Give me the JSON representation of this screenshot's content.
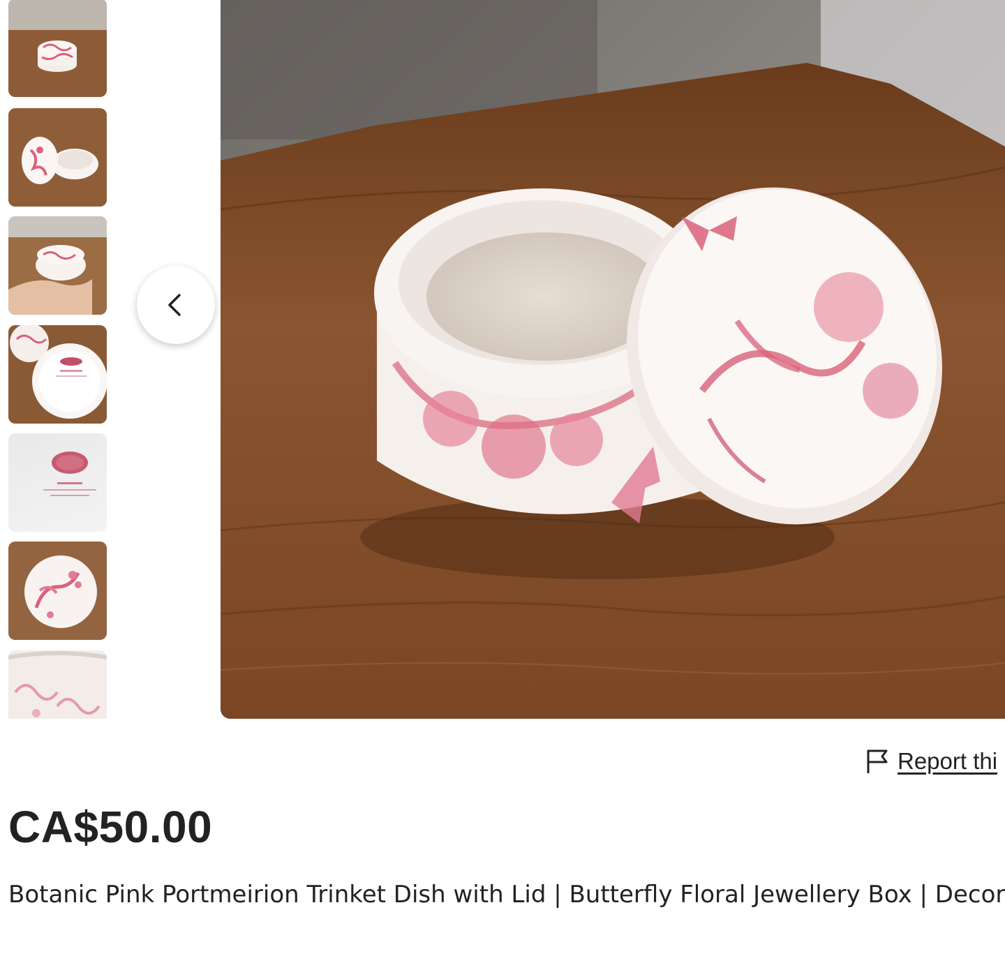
{
  "gallery": {
    "thumbnails": [
      {
        "icon": "lidded-dish-closed"
      },
      {
        "icon": "lidded-dish-open"
      },
      {
        "icon": "dish-in-hand"
      },
      {
        "icon": "dish-underside"
      },
      {
        "icon": "backstamp"
      },
      {
        "icon": "lid-top"
      },
      {
        "icon": "dish-side"
      }
    ],
    "prev_icon": "chevron-left-icon",
    "main_image_alt": "lidded-dish-open"
  },
  "listing": {
    "report_label": "Report thi",
    "report_icon": "flag-icon",
    "price": "CA$50.00",
    "title": "Botanic Pink Portmeirion Trinket Dish with Lid | Butterfly Floral Jewellery Box | Decor"
  },
  "colors": {
    "text": "#222222",
    "wood": "#7a4a26",
    "pattern_pink": "#d9627a"
  }
}
